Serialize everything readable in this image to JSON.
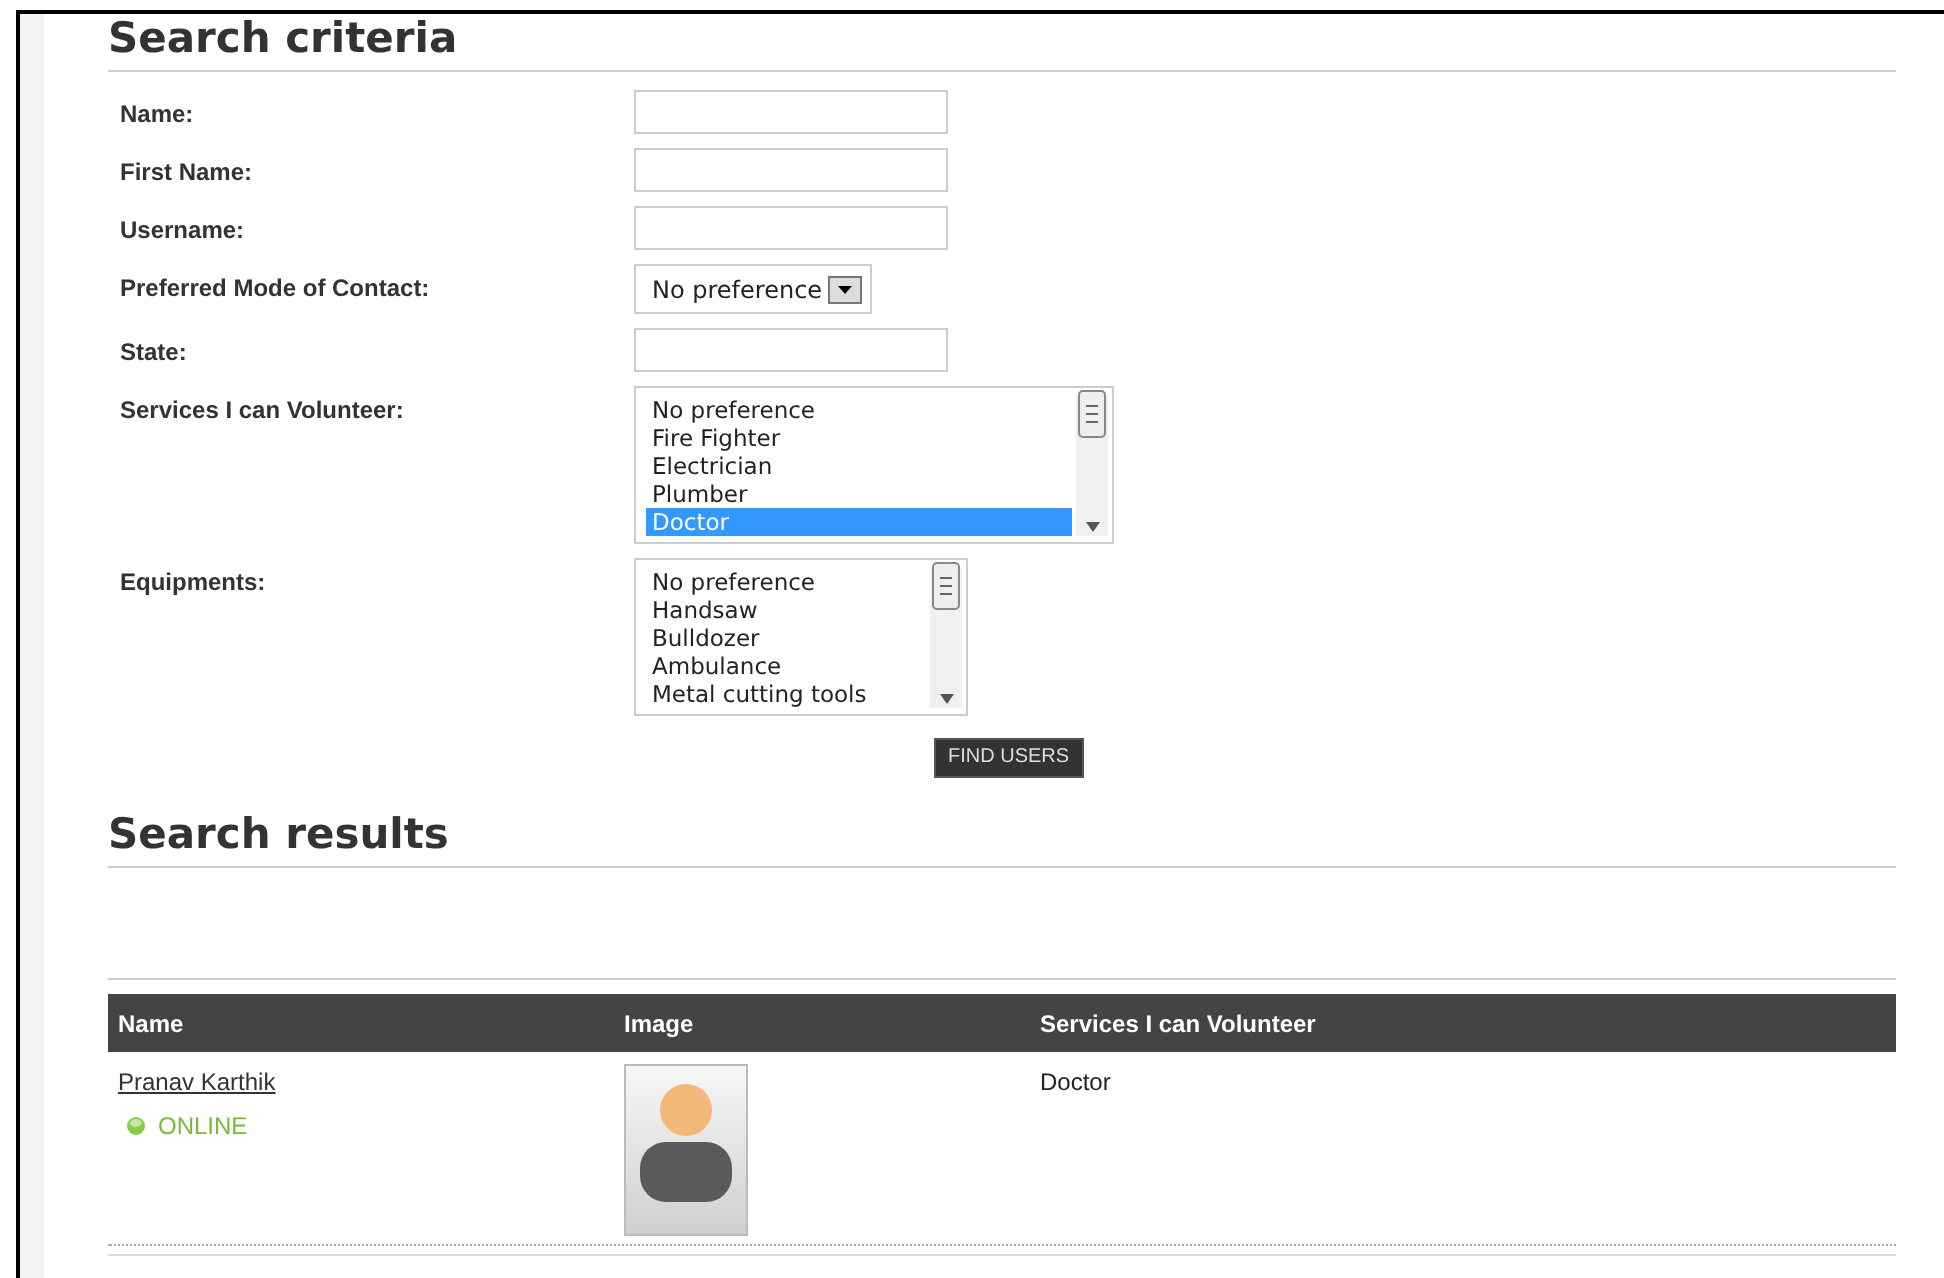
{
  "criteria": {
    "title": "Search criteria",
    "fields": [
      {
        "kind": "text",
        "label": "Name:"
      },
      {
        "kind": "text",
        "label": "First Name:"
      },
      {
        "kind": "text",
        "label": "Username:"
      },
      {
        "kind": "select",
        "label": "Preferred Mode of Contact:",
        "value": "No preference"
      },
      {
        "kind": "text",
        "label": "State:"
      },
      {
        "kind": "list",
        "label": "Services I can Volunteer:",
        "options": [
          {
            "text": "No preference",
            "selected": false
          },
          {
            "text": "Fire Fighter",
            "selected": false
          },
          {
            "text": "Electrician",
            "selected": false
          },
          {
            "text": "Plumber",
            "selected": false
          },
          {
            "text": "Doctor",
            "selected": true
          }
        ]
      },
      {
        "kind": "list",
        "label": "Equipments:",
        "options": [
          {
            "text": "No preference",
            "selected": false
          },
          {
            "text": "Handsaw",
            "selected": false
          },
          {
            "text": "Bulldozer",
            "selected": false
          },
          {
            "text": "Ambulance",
            "selected": false
          },
          {
            "text": "Metal cutting tools",
            "selected": false
          }
        ]
      }
    ],
    "button": "FIND USERS"
  },
  "results": {
    "title": "Search results",
    "columns": [
      "Name",
      "Image",
      "Services I can Volunteer"
    ],
    "rows": [
      {
        "name": "Pranav Karthik",
        "online": true,
        "status": "ONLINE",
        "services": "Doctor"
      }
    ]
  }
}
